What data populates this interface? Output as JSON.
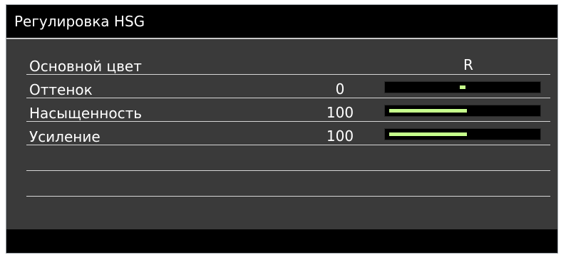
{
  "window": {
    "title": "Регулировка HSG"
  },
  "colors": {
    "background": "#3a3a3a",
    "header": "#000000",
    "bar_fill": "#c6ff8c",
    "bar_track": "#000000",
    "text": "#ffffff"
  },
  "menu": {
    "primary_color": {
      "label": "Основной цвет",
      "value": "R"
    },
    "hue": {
      "label": "Оттенок",
      "value": "0",
      "level": 0
    },
    "saturation": {
      "label": "Насыщенность",
      "value": "100",
      "level": 100
    },
    "gain": {
      "label": "Усиление",
      "value": "100",
      "level": 100
    }
  }
}
